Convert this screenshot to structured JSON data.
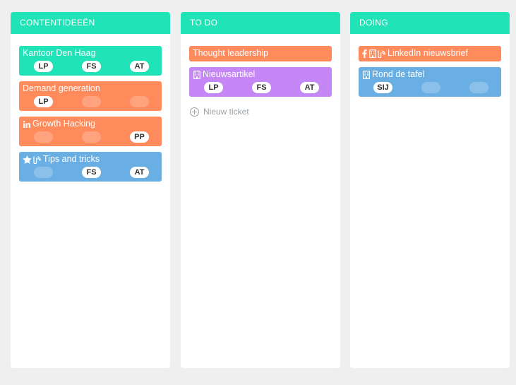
{
  "columns": [
    {
      "title": "CONTENTIDEEËN",
      "cards": [
        {
          "title": "Kantoor Den Haag",
          "color": "#20e3b8",
          "icons": [],
          "badges": [
            "LP",
            "FS",
            "AT"
          ]
        },
        {
          "title": "Demand generation",
          "color": "#ff8a5c",
          "icons": [],
          "badges": [
            "LP",
            "",
            ""
          ]
        },
        {
          "title": "Growth Hacking",
          "color": "#ff8a5c",
          "icons": [
            "linkedin-icon"
          ],
          "badges": [
            "",
            "",
            "PP"
          ]
        },
        {
          "title": "Tips and tricks",
          "color": "#6aafe3",
          "icons": [
            "star-icon",
            "blog-icon"
          ],
          "badges": [
            "",
            "FS",
            "AT"
          ]
        }
      ]
    },
    {
      "title": "TO DO",
      "cards": [
        {
          "title": "Thought leadership",
          "color": "#ff8a5c",
          "icons": [],
          "badges": []
        },
        {
          "title": "Nieuwsartikel",
          "color": "#c487f5",
          "icons": [
            "building-icon"
          ],
          "badges": [
            "LP",
            "FS",
            "AT"
          ]
        }
      ],
      "new_ticket": "Nieuw ticket"
    },
    {
      "title": "DOING",
      "cards": [
        {
          "title": "LinkedIn nieuwsbrief",
          "color": "#ff8a5c",
          "icons": [
            "facebook-icon",
            "building-icon",
            "blog-icon"
          ],
          "badges": []
        },
        {
          "title": "Rond de tafel",
          "color": "#6aafe3",
          "icons": [
            "building-icon"
          ],
          "badges": [
            "SIJ",
            "",
            ""
          ]
        }
      ]
    }
  ]
}
